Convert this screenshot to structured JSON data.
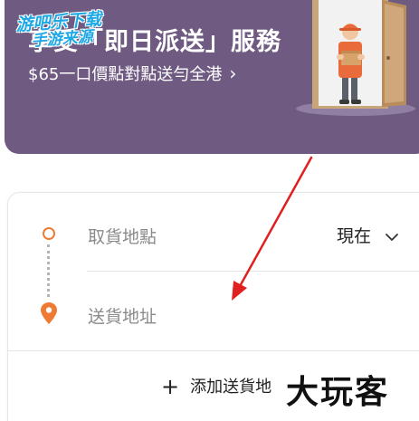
{
  "banner": {
    "title": "享受「即日派送」服務",
    "subtitle": "$65一口價點對點送勻全港",
    "subtitle_arrow": "›",
    "illustration_icon": "delivery-person-door-illustration",
    "bg_color": "#6f5a82"
  },
  "watermark_top": {
    "line1": "游吧乐下载",
    "line2": "手游来源"
  },
  "route": {
    "pickup_placeholder": "取貨地點",
    "dropoff_placeholder": "送貨地址",
    "pickup_icon": "circle-dot-icon",
    "dropoff_icon": "location-pin-icon",
    "accent_color": "#ee7a33"
  },
  "time": {
    "selected": "現在",
    "icon": "chevron-down-icon"
  },
  "add_dropoff": {
    "icon": "plus-icon",
    "label": "添加送貨地"
  },
  "watermark_bottom": {
    "text": "大玩客"
  },
  "annotation": {
    "color": "#e02020",
    "icon": "red-arrow-annotation"
  }
}
